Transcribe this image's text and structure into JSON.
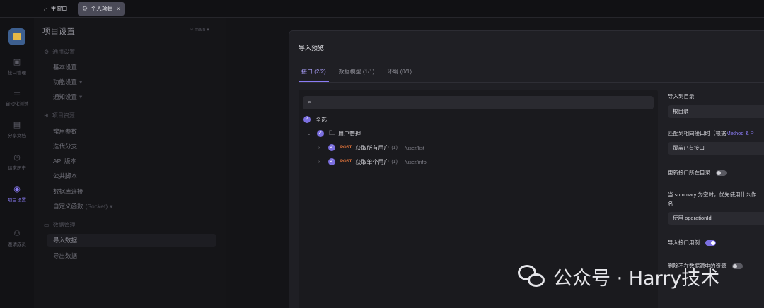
{
  "topbar": {
    "tabs": [
      {
        "label": "主窗口",
        "icon": "home-icon"
      },
      {
        "label": "个人项目",
        "icon": "project-icon",
        "close": "×"
      }
    ]
  },
  "rail": {
    "items": [
      {
        "label": "接口管理",
        "icon": "api-icon"
      },
      {
        "label": "自动化测试",
        "icon": "test-icon"
      },
      {
        "label": "分享文档",
        "icon": "book-icon"
      },
      {
        "label": "请求历史",
        "icon": "history-icon"
      },
      {
        "label": "项目设置",
        "icon": "settings-icon",
        "active": true
      },
      {
        "label": "邀请成员",
        "icon": "invite-icon"
      }
    ]
  },
  "sidebar": {
    "title": "项目设置",
    "branch": "main",
    "sections": [
      {
        "label": "通用设置",
        "items": [
          {
            "label": "基本设置"
          },
          {
            "label": "功能设置"
          },
          {
            "label": "通知设置"
          }
        ]
      },
      {
        "label": "项目资源",
        "items": [
          {
            "label": "常用参数"
          },
          {
            "label": "迭代分支"
          },
          {
            "label": "API 版本"
          },
          {
            "label": "公共脚本"
          },
          {
            "label": "数据库连接"
          },
          {
            "label": "自定义函数",
            "sub": "(Socket)"
          }
        ]
      },
      {
        "label": "数据管理",
        "items": [
          {
            "label": "导入数据",
            "selected": true
          },
          {
            "label": "导出数据"
          }
        ]
      }
    ]
  },
  "modal": {
    "title": "导入预览",
    "tabs": [
      {
        "label": "接口 (2/2)",
        "active": true
      },
      {
        "label": "数据模型 (1/1)"
      },
      {
        "label": "环境 (0/1)"
      }
    ],
    "tree": {
      "select_all": "全选",
      "folder": "用户管理",
      "apis": [
        {
          "method": "POST",
          "name": "获取所有用户",
          "count": "(1)",
          "path": "/user/list"
        },
        {
          "method": "POST",
          "name": "获取单个用户",
          "count": "(1)",
          "path": "/user/info"
        }
      ]
    },
    "options": {
      "target_dir_label": "导入到目录",
      "target_dir_value": "根目录",
      "match_label": "匹配到相同接口时（根据",
      "match_label_accent": "Method & P",
      "match_value": "覆盖已有接口",
      "update_dir_label": "更新接口所在目录",
      "summary_label_1": "当 summary 为空时，优先使用什么作",
      "summary_label_2": "名",
      "summary_value": "使用 operationId",
      "import_cases_label": "导入接口用例",
      "delete_missing_label": "删除不在数据源中的资源"
    }
  },
  "watermark": "公众号 · Harry技术"
}
